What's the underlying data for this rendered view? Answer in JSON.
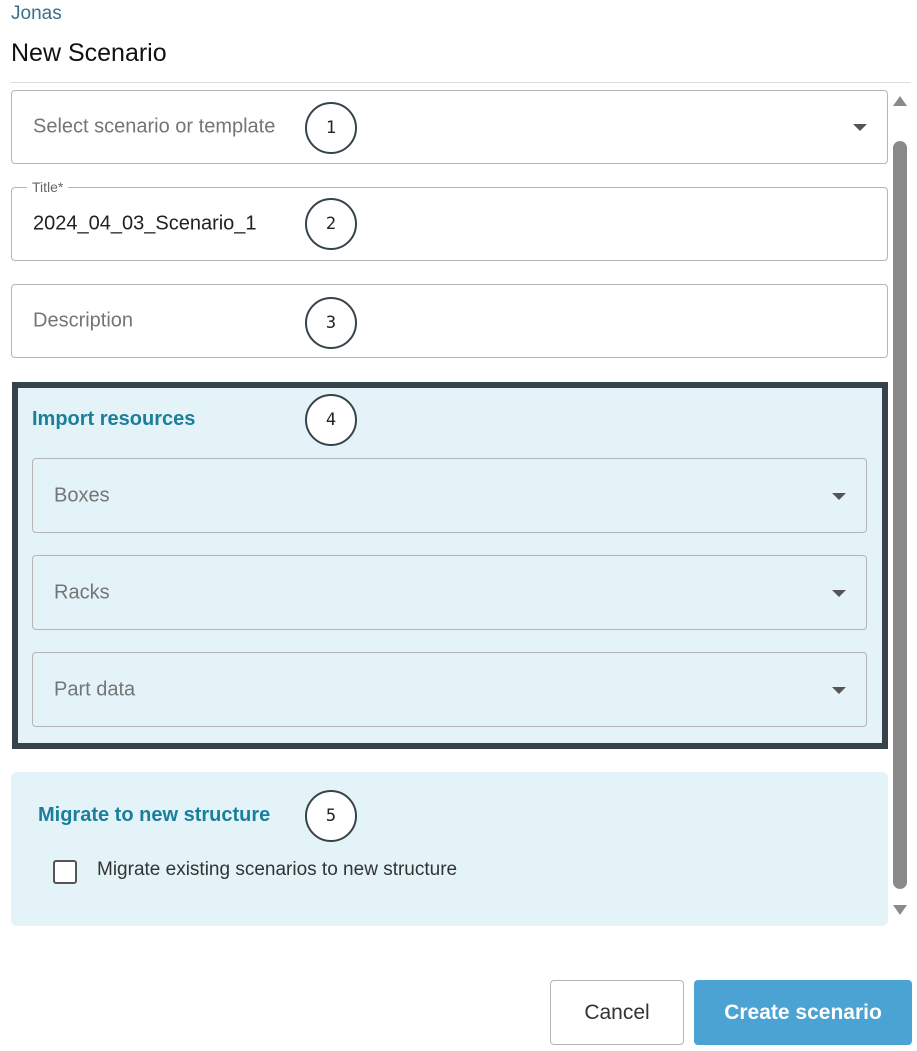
{
  "breadcrumb": "Jonas",
  "title": "New Scenario",
  "scenario_select": {
    "placeholder": "Select scenario or template",
    "callout": "1"
  },
  "title_field": {
    "label": "Title*",
    "value": "2024_04_03_Scenario_1",
    "callout": "2"
  },
  "description_field": {
    "placeholder": "Description",
    "callout": "3"
  },
  "import_resources": {
    "heading": "Import resources",
    "callout": "4",
    "dropdowns": [
      {
        "placeholder": "Boxes"
      },
      {
        "placeholder": "Racks"
      },
      {
        "placeholder": "Part data"
      }
    ]
  },
  "migrate": {
    "heading": "Migrate to new structure",
    "callout": "5",
    "checkbox_label": "Migrate existing scenarios to new structure",
    "checked": false
  },
  "buttons": {
    "cancel": "Cancel",
    "create": "Create scenario"
  },
  "colors": {
    "accent": "#1b7f9c",
    "primary_button": "#4aa3d2",
    "panel_bg": "#e3f3f8",
    "highlight_border": "#37434a"
  },
  "icons": [
    "chevron-down-icon",
    "scroll-up-icon",
    "scroll-down-icon",
    "checkbox-icon"
  ]
}
